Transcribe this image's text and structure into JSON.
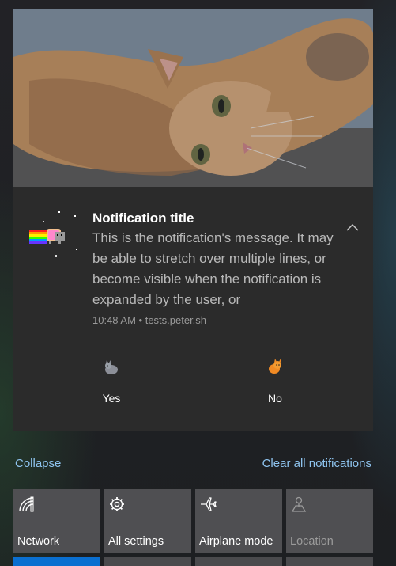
{
  "notification": {
    "title": "Notification title",
    "message": "This is the notification's message. It may be able to stretch over multiple lines, or become visible when the notification is expanded by the user, or",
    "meta": "10:48 AM • tests.peter.sh",
    "actions": [
      {
        "label": "Yes",
        "icon": "cat-grey-icon"
      },
      {
        "label": "No",
        "icon": "cat-orange-icon"
      }
    ]
  },
  "panel": {
    "collapse_label": "Collapse",
    "clear_all_label": "Clear all notifications"
  },
  "quick_actions": [
    {
      "label": "Network",
      "icon": "network-icon",
      "enabled": true
    },
    {
      "label": "All settings",
      "icon": "gear-icon",
      "enabled": true
    },
    {
      "label": "Airplane mode",
      "icon": "airplane-icon",
      "enabled": true
    },
    {
      "label": "Location",
      "icon": "location-icon",
      "enabled": false
    }
  ],
  "colors": {
    "link": "#8fc4ef",
    "tile": "#4f4f52",
    "accent": "#0a6fd0",
    "card": "#2b2b2b"
  }
}
